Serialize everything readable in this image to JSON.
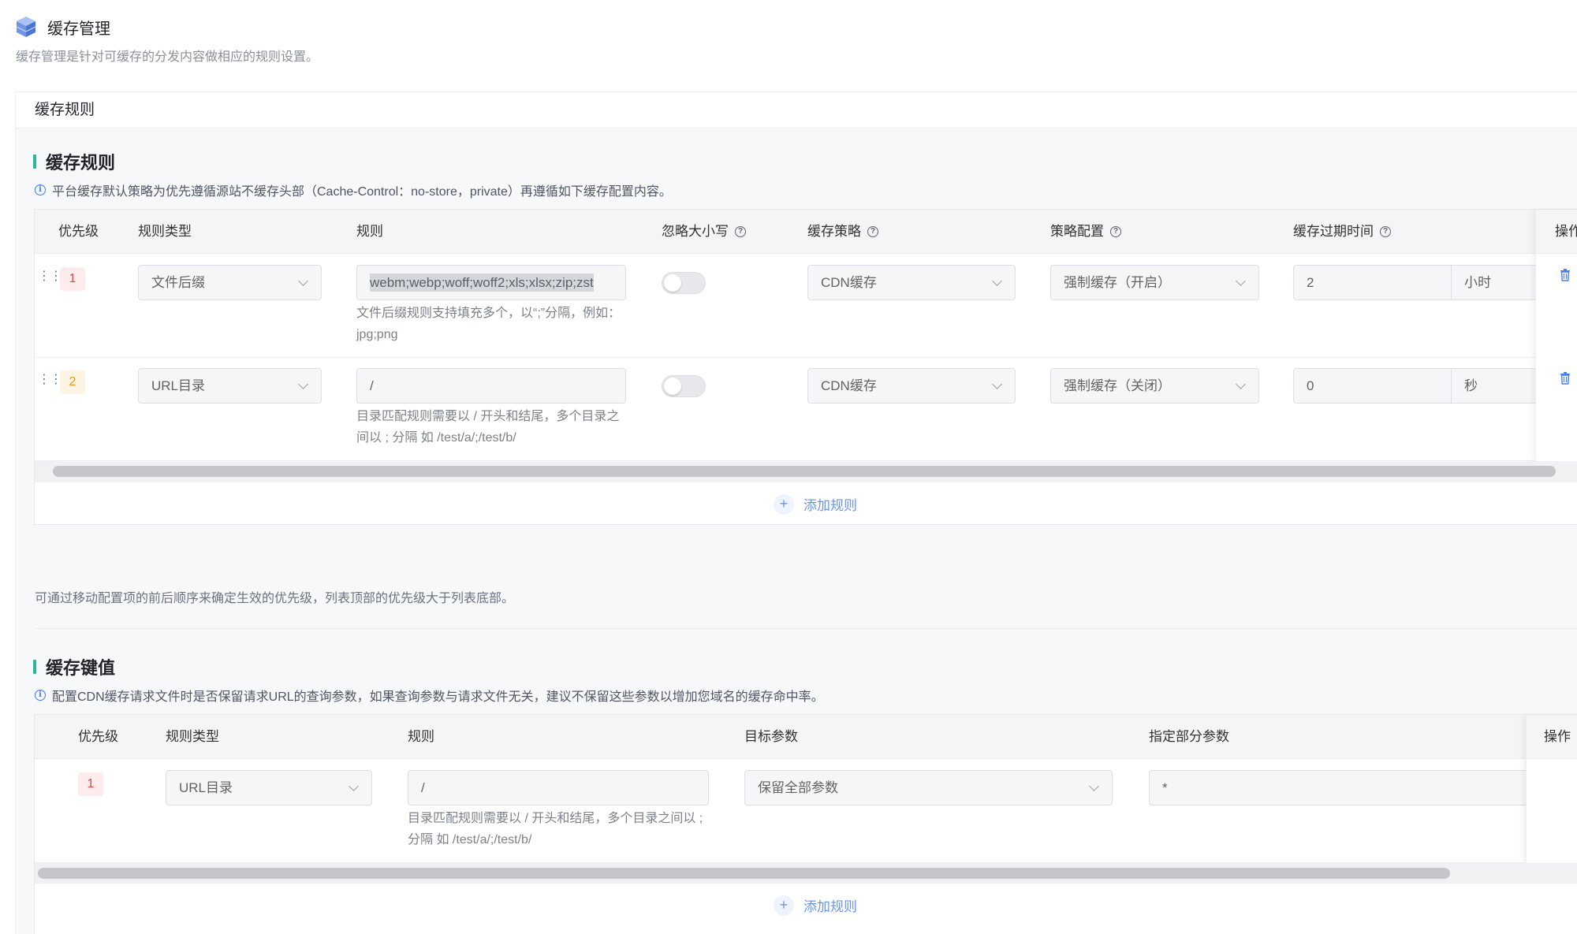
{
  "header": {
    "title": "缓存管理",
    "description": "缓存管理是针对可缓存的分发内容做相应的规则设置。"
  },
  "card": {
    "tab_label": "缓存规则"
  },
  "rules_section": {
    "title": "缓存规则",
    "tip": "平台缓存默认策略为优先遵循源站不缓存头部（Cache-Control：no-store，private）再遵循如下缓存配置内容。",
    "columns": {
      "priority": "优先级",
      "rule_type": "规则类型",
      "rule": "规则",
      "ignore_case": "忽略大小写",
      "cache_policy": "缓存策略",
      "policy_config": "策略配置",
      "expire_time": "缓存过期时间",
      "actions": "操作"
    },
    "rows": [
      {
        "priority": "1",
        "rule_type": "文件后缀",
        "rule": "webm;webp;woff;woff2;xls;xlsx;zip;zst",
        "hint": "文件后缀规则支持填充多个，以“;”分隔，例如：jpg;png",
        "ignore_case": false,
        "cache_policy": "CDN缓存",
        "policy_config": "强制缓存（开启）",
        "expire_value": "2",
        "expire_unit": "小时"
      },
      {
        "priority": "2",
        "rule_type": "URL目录",
        "rule": "/",
        "hint": "目录匹配规则需要以 / 开头和结尾，多个目录之间以 ; 分隔 如 /test/a/;/test/b/",
        "ignore_case": false,
        "cache_policy": "CDN缓存",
        "policy_config": "强制缓存（关闭）",
        "expire_value": "0",
        "expire_unit": "秒"
      }
    ],
    "add_label": "添加规则",
    "note": "可通过移动配置项的前后顺序来确定生效的优先级，列表顶部的优先级大于列表底部。"
  },
  "key_section": {
    "title": "缓存键值",
    "tip": "配置CDN缓存请求文件时是否保留请求URL的查询参数，如果查询参数与请求文件无关，建议不保留这些参数以增加您域名的缓存命中率。",
    "columns": {
      "priority": "优先级",
      "rule_type": "规则类型",
      "rule": "规则",
      "target_param": "目标参数",
      "partial_param": "指定部分参数",
      "actions": "操作"
    },
    "rows": [
      {
        "priority": "1",
        "rule_type": "URL目录",
        "rule": "/",
        "hint": "目录匹配规则需要以 / 开头和结尾，多个目录之间以 ; 分隔 如 /test/a/;/test/b/",
        "target_param": "保留全部参数",
        "partial_param": "*"
      }
    ],
    "add_label": "添加规则"
  },
  "colors": {
    "accent_bar": "#2bb89a",
    "info_blue": "#3a7bf7",
    "priority_red": "#e84a4a",
    "priority_orange": "#e49b1b",
    "link_blue": "#6c95e8"
  }
}
